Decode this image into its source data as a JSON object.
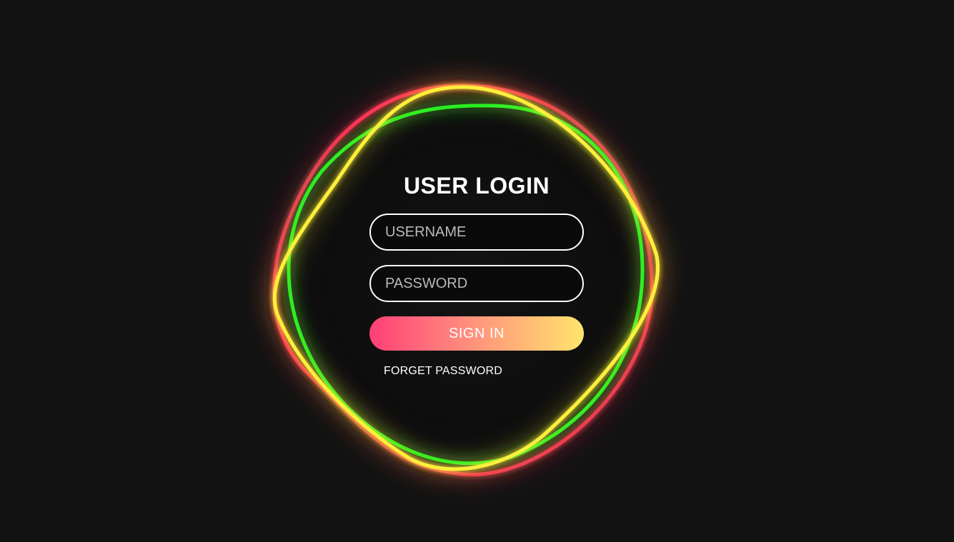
{
  "login": {
    "title": "USER LOGIN",
    "username_placeholder": "USERNAME",
    "password_placeholder": "PASSWORD",
    "signin_label": "SIGN IN",
    "forgot_label": "FORGET PASSWORD"
  },
  "colors": {
    "background": "#121212",
    "ring_red": "#ff2a5a",
    "ring_green": "#22ee22",
    "ring_yellow": "#ffef3a",
    "button_gradient_start": "#ff3f76",
    "button_gradient_end": "#ffe46d"
  }
}
